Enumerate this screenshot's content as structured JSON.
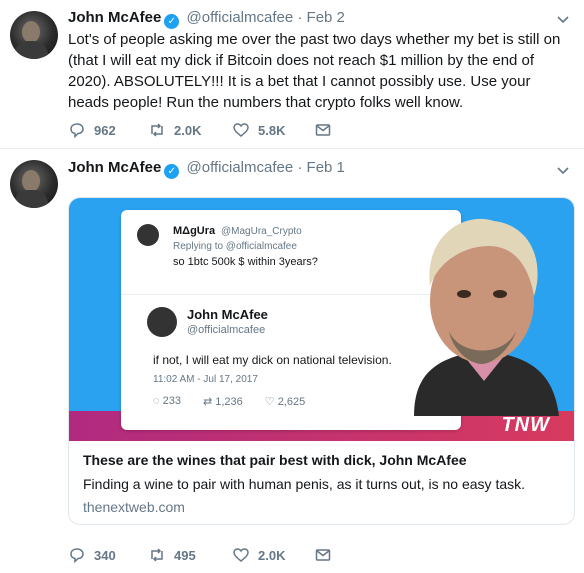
{
  "tweets": [
    {
      "name": "John McAfee",
      "handle": "@officialmcafee",
      "dot": "·",
      "date": "Feb 2",
      "text": "Lot's of people asking me over the past two days whether my bet is still on (that I will eat my dick if Bitcoin does not reach $1 million by the end of 2020). ABSOLUTELY!!! It is a bet that I cannot possibly use. Use your heads people! Run the numbers that crypto folks well know.",
      "replies": "962",
      "retweets": "2.0K",
      "likes": "5.8K"
    },
    {
      "name": "John McAfee",
      "handle": "@officialmcafee",
      "dot": "·",
      "date": "Feb 1",
      "card": {
        "embedded": {
          "reply_name": "MΔgUra",
          "reply_handle": "@MagUra_Crypto",
          "replying_to": "Replying to @officialmcafee",
          "reply_text": "so 1btc 500k $ within 3years?",
          "main_name": "John McAfee",
          "main_handle": "@officialmcafee",
          "main_text": "if not, I will eat my dick on national television.",
          "timestamp": "11:02 AM - Jul 17, 2017",
          "replies": "233",
          "retweets": "1,236",
          "likes": "2,625"
        },
        "brand": "TNW",
        "title": "These are the wines that pair best with dick, John McAfee",
        "description": "Finding a wine to pair with human penis, as it turns out, is no easy task.",
        "domain": "thenextweb.com"
      },
      "replies": "340",
      "retweets": "495",
      "likes": "2.0K"
    }
  ],
  "colors": {
    "accent": "#1da1f2",
    "secondary_text": "#657786",
    "card_bg": "#2aa2f0",
    "band": "#c8326c"
  },
  "icons": [
    "reply-icon",
    "retweet-icon",
    "like-icon",
    "message-icon",
    "caret-down-icon",
    "verified-icon"
  ]
}
